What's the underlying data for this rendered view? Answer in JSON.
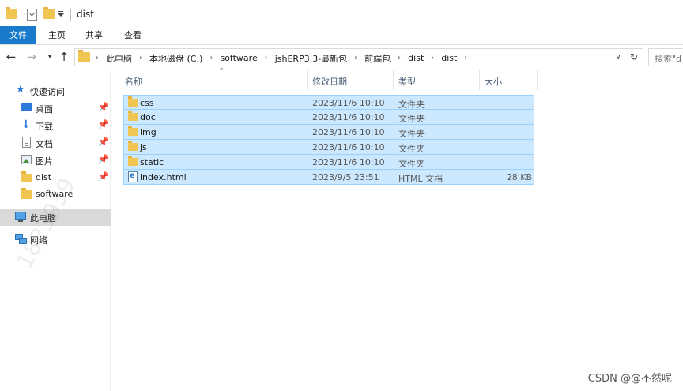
{
  "window": {
    "title": "dist"
  },
  "ribbon": {
    "tabs": [
      "文件",
      "主页",
      "共享",
      "查看"
    ]
  },
  "nav": {
    "back_icon": "back-arrow",
    "forward_icon": "forward-arrow",
    "recent_icon": "chevron-down",
    "up_icon": "up-arrow"
  },
  "address": {
    "crumbs": [
      "此电脑",
      "本地磁盘 (C:)",
      "software",
      "jshERP3.3-最新包",
      "前端包",
      "dist",
      "dist"
    ]
  },
  "search": {
    "placeholder": "搜索\"d"
  },
  "sidebar": {
    "items": [
      {
        "label": "快速访问",
        "icon": "star-icon",
        "pinned": false
      },
      {
        "label": "桌面",
        "icon": "desktop-icon",
        "pinned": true
      },
      {
        "label": "下载",
        "icon": "download-icon",
        "pinned": true
      },
      {
        "label": "文档",
        "icon": "document-icon",
        "pinned": true
      },
      {
        "label": "图片",
        "icon": "pictures-icon",
        "pinned": true
      },
      {
        "label": "dist",
        "icon": "folder-icon",
        "pinned": true
      },
      {
        "label": "software",
        "icon": "folder-icon",
        "pinned": false
      },
      {
        "label": "此电脑",
        "icon": "computer-icon",
        "pinned": false,
        "selected": true
      },
      {
        "label": "网络",
        "icon": "network-icon",
        "pinned": false
      }
    ]
  },
  "columns": [
    "名称",
    "修改日期",
    "类型",
    "大小"
  ],
  "files": [
    {
      "name": "css",
      "modified": "2023/11/6 10:10",
      "type": "文件夹",
      "size": "",
      "kind": "folder"
    },
    {
      "name": "doc",
      "modified": "2023/11/6 10:10",
      "type": "文件夹",
      "size": "",
      "kind": "folder"
    },
    {
      "name": "img",
      "modified": "2023/11/6 10:10",
      "type": "文件夹",
      "size": "",
      "kind": "folder"
    },
    {
      "name": "js",
      "modified": "2023/11/6 10:10",
      "type": "文件夹",
      "size": "",
      "kind": "folder"
    },
    {
      "name": "static",
      "modified": "2023/11/6 10:10",
      "type": "文件夹",
      "size": "",
      "kind": "folder"
    },
    {
      "name": "index.html",
      "modified": "2023/9/5 23:51",
      "type": "HTML 文档",
      "size": "28 KB",
      "kind": "html"
    }
  ],
  "watermark": {
    "text": "1823939"
  },
  "credit": {
    "text": "CSDN @@不然呢"
  },
  "colors": {
    "file_tab": "#1979ca",
    "selection": "#cce8ff",
    "selection_border": "#99d1ff",
    "folder": "#f0c552"
  }
}
